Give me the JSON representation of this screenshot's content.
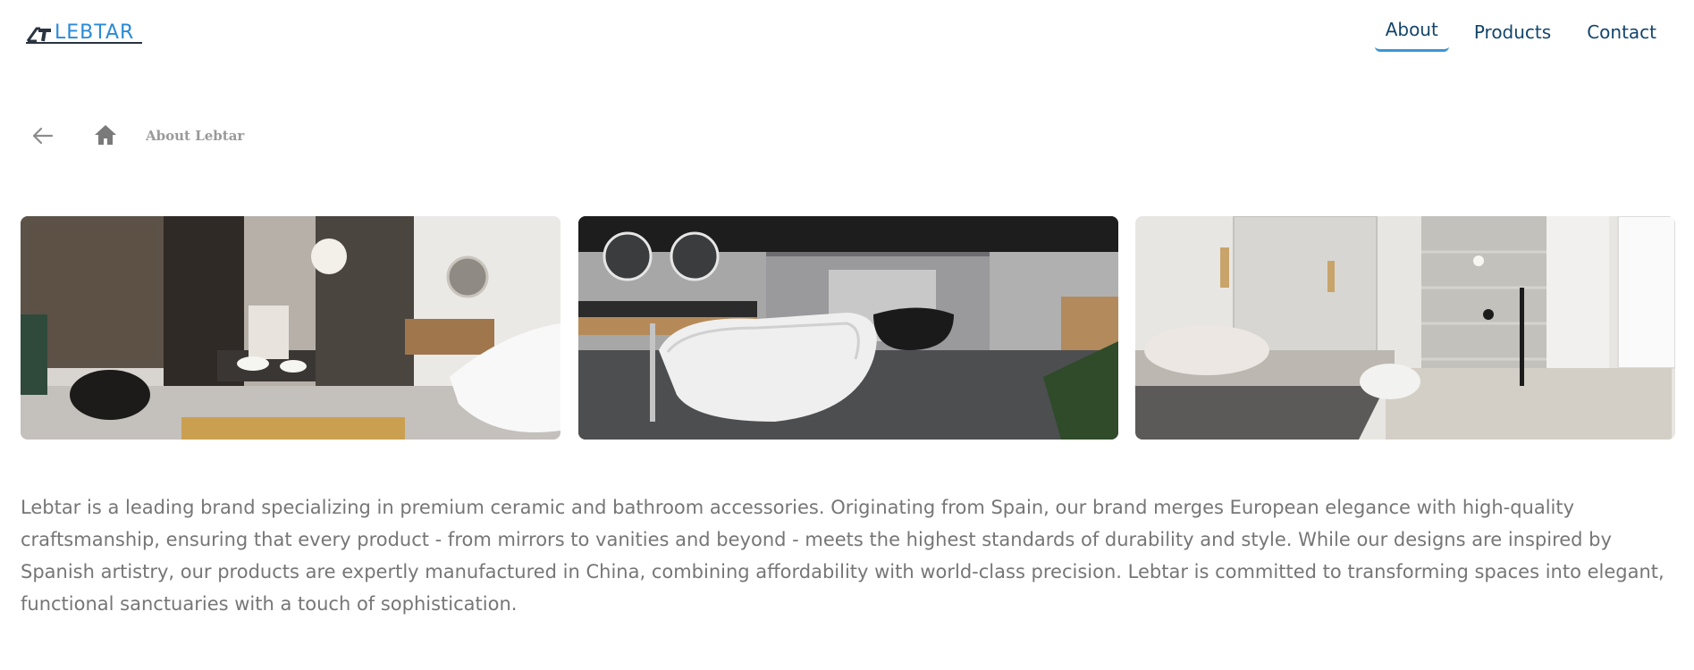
{
  "header": {
    "logo_text": "LEBTAR",
    "logo_icon": "lt-monogram-logo",
    "nav": [
      {
        "label": "About",
        "active": true
      },
      {
        "label": "Products",
        "active": false
      },
      {
        "label": "Contact",
        "active": false
      }
    ]
  },
  "breadcrumb": {
    "back_icon": "arrow-left-icon",
    "home_icon": "home-icon",
    "label": "About Lebtar"
  },
  "gallery": [
    {
      "scene": "showroom-dark-freestanding-basin"
    },
    {
      "scene": "showroom-white-freestanding-bathtub"
    },
    {
      "scene": "bathroom-vanity-and-glass-shower"
    }
  ],
  "about": {
    "paragraph": "Lebtar is a leading brand specializing in premium ceramic and bathroom accessories. Originating from Spain, our brand merges European elegance with high-quality craftsmanship, ensuring that every product - from mirrors to vanities and beyond - meets the highest standards of durability and style. While our designs are inspired by Spanish artistry, our products are expertly manufactured in China, combining affordability with world-class precision. Lebtar is committed to transforming spaces into elegant, functional sanctuaries with a touch of sophistication."
  },
  "colors": {
    "nav_text": "#14456b",
    "nav_active_underline": "#3a95d8",
    "logo_blue": "#2a8ad6",
    "body_text": "#767676",
    "breadcrumb_text": "#9a9a9a"
  }
}
